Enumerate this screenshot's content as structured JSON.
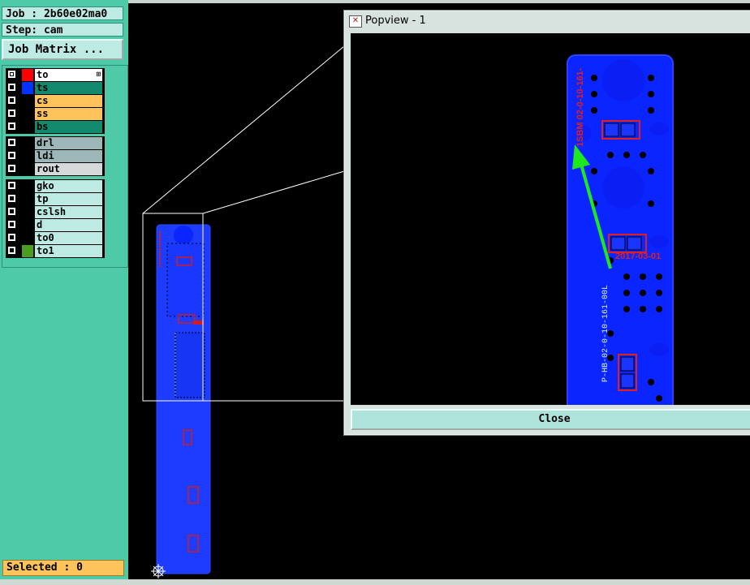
{
  "info": {
    "job": "Job : 2b60e02ma0",
    "step": "Step: cam",
    "job_matrix": "Job Matrix ..."
  },
  "layer_groups": [
    [
      {
        "name": "to",
        "color": "#ffffff",
        "swatch": "#ff0000",
        "selected": true,
        "marker": "⊞"
      },
      {
        "name": "ts",
        "color": "#13896e",
        "swatch": "#0033ff"
      },
      {
        "name": "cs",
        "color": "#fec35a",
        "swatch": "#000000"
      },
      {
        "name": "ss",
        "color": "#fec35a",
        "swatch": "#000000"
      },
      {
        "name": "bs",
        "color": "#13896e",
        "swatch": "#000000"
      }
    ],
    [
      {
        "name": "drl",
        "color": "#9db7b9",
        "swatch": "#000000"
      },
      {
        "name": "ldi",
        "color": "#9db7b9",
        "swatch": "#000000"
      },
      {
        "name": "rout",
        "color": "#d4d9d9",
        "swatch": "#000000"
      }
    ],
    [
      {
        "name": "gko",
        "color": "#bdebe3",
        "swatch": "#000000"
      },
      {
        "name": "tp",
        "color": "#bdebe3",
        "swatch": "#000000"
      },
      {
        "name": "cslsh",
        "color": "#bdebe3",
        "swatch": "#000000"
      },
      {
        "name": "d",
        "color": "#bdebe3",
        "swatch": "#000000"
      },
      {
        "name": "to0",
        "color": "#bdebe3",
        "swatch": "#000000"
      },
      {
        "name": "to1",
        "color": "#bdebe3",
        "swatch": "#4a9d20"
      }
    ]
  ],
  "status": {
    "selected": "Selected : 0"
  },
  "popview": {
    "title": "Popview - 1",
    "close_label": "Close",
    "icon_glyph": "✕"
  },
  "pcb_text": {
    "red_vertical": "1SBM 02-0-10-161-",
    "red_date": "2017-03-01",
    "silk_vertical": "P-HB-02-0-10-161-00L"
  }
}
